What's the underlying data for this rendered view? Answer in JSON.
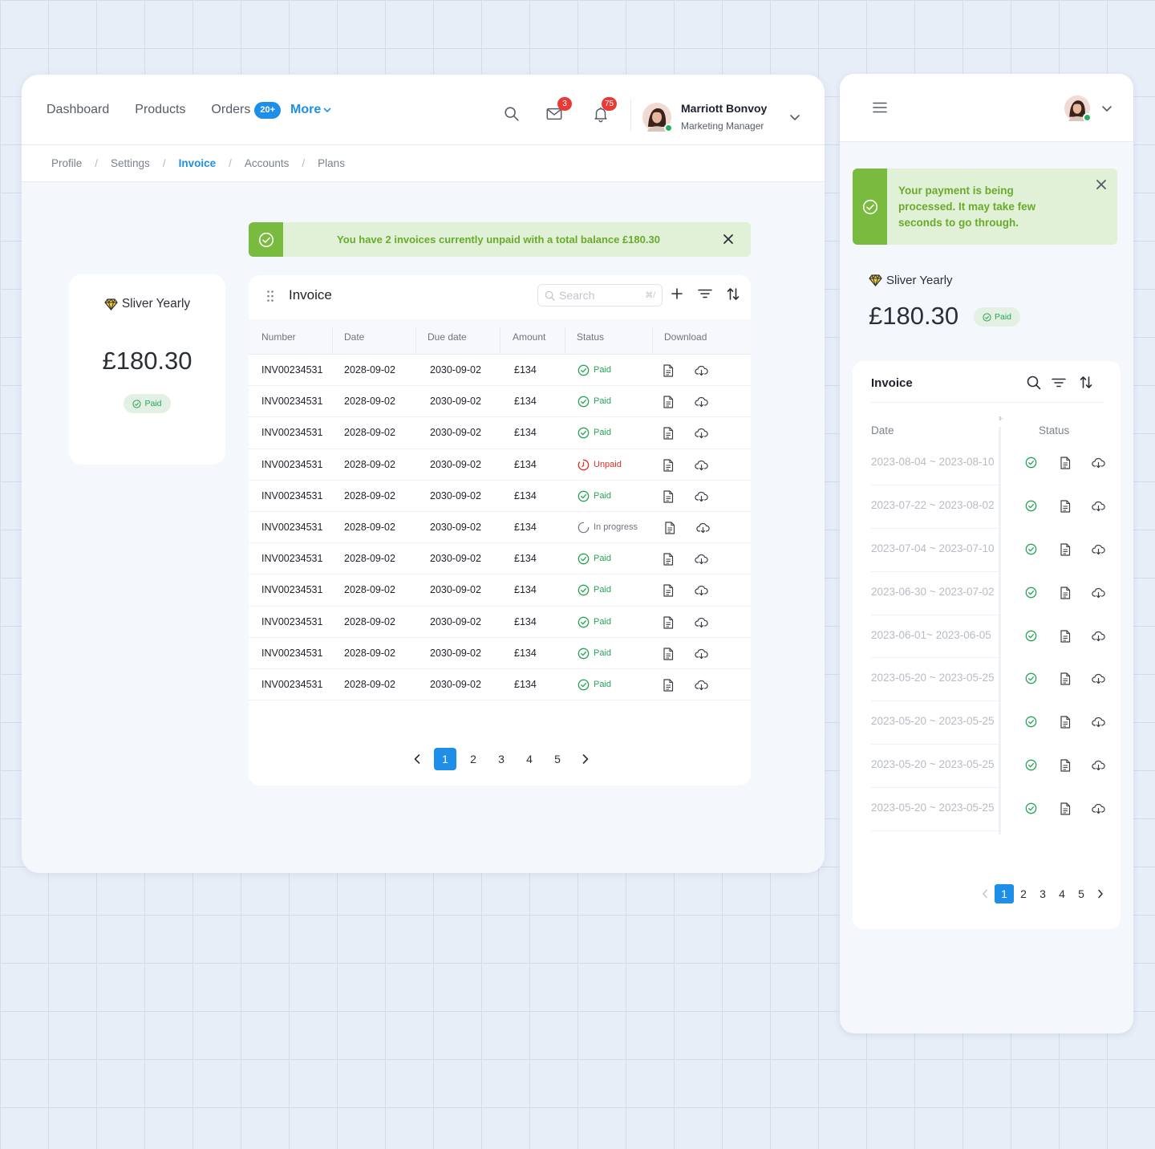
{
  "desktop": {
    "nav": {
      "dashboard": "Dashboard",
      "products": "Products",
      "orders": "Orders",
      "orders_badge": "20+",
      "more": "More"
    },
    "mail_count": "3",
    "notification_count": "75",
    "user": {
      "name": "Marriott Bonvoy",
      "role": "Marketing Manager"
    },
    "breadcrumb": [
      "Profile",
      "Settings",
      "Invoice",
      "Accounts",
      "Plans"
    ],
    "breadcrumb_active": "Invoice",
    "alert_text": "You have 2 invoices currently unpaid with a total balance £180.30",
    "plan": {
      "name": "Sliver Yearly",
      "price": "£180.30",
      "status": "Paid"
    },
    "invoice": {
      "title": "Invoice",
      "search_placeholder": "Search",
      "search_shortcut": "⌘/",
      "columns": [
        "Number",
        "Date",
        "Due date",
        "Amount",
        "Status",
        "Download"
      ],
      "rows": [
        {
          "number": "INV00234531",
          "date": "2028-09-02",
          "due": "2030-09-02",
          "amount": "£134",
          "status": "Paid",
          "type": "paid"
        },
        {
          "number": "INV00234531",
          "date": "2028-09-02",
          "due": "2030-09-02",
          "amount": "£134",
          "status": "Paid",
          "type": "paid"
        },
        {
          "number": "INV00234531",
          "date": "2028-09-02",
          "due": "2030-09-02",
          "amount": "£134",
          "status": "Paid",
          "type": "paid"
        },
        {
          "number": "INV00234531",
          "date": "2028-09-02",
          "due": "2030-09-02",
          "amount": "£134",
          "status": "Unpaid",
          "type": "unpaid"
        },
        {
          "number": "INV00234531",
          "date": "2028-09-02",
          "due": "2030-09-02",
          "amount": "£134",
          "status": "Paid",
          "type": "paid"
        },
        {
          "number": "INV00234531",
          "date": "2028-09-02",
          "due": "2030-09-02",
          "amount": "£134",
          "status": "In progress",
          "type": "progress"
        },
        {
          "number": "INV00234531",
          "date": "2028-09-02",
          "due": "2030-09-02",
          "amount": "£134",
          "status": "Paid",
          "type": "paid"
        },
        {
          "number": "INV00234531",
          "date": "2028-09-02",
          "due": "2030-09-02",
          "amount": "£134",
          "status": "Paid",
          "type": "paid"
        },
        {
          "number": "INV00234531",
          "date": "2028-09-02",
          "due": "2030-09-02",
          "amount": "£134",
          "status": "Paid",
          "type": "paid"
        },
        {
          "number": "INV00234531",
          "date": "2028-09-02",
          "due": "2030-09-02",
          "amount": "£134",
          "status": "Paid",
          "type": "paid"
        },
        {
          "number": "INV00234531",
          "date": "2028-09-02",
          "due": "2030-09-02",
          "amount": "£134",
          "status": "Paid",
          "type": "paid"
        }
      ],
      "pages": [
        "1",
        "2",
        "3",
        "4",
        "5"
      ],
      "current_page": "1"
    }
  },
  "mobile": {
    "alert_text": "Your payment is being processed. It may take few seconds to go through.",
    "plan": {
      "name": "Sliver Yearly",
      "price": "£180.30",
      "status": "Paid"
    },
    "invoice": {
      "title": "Invoice",
      "col_date": "Date",
      "col_status": "Status",
      "rows": [
        "2023-08-04 ~ 2023-08-10",
        "2023-07-22 ~ 2023-08-02",
        "2023-07-04 ~ 2023-07-10",
        "2023-06-30 ~ 2023-07-02",
        "2023-06-01~ 2023-06-05",
        "2023-05-20 ~ 2023-05-25",
        "2023-05-20 ~ 2023-05-25",
        "2023-05-20 ~ 2023-05-25",
        "2023-05-20 ~ 2023-05-25"
      ],
      "pages": [
        "1",
        "2",
        "3",
        "4",
        "5"
      ],
      "current_page": "1"
    }
  },
  "colors": {
    "accent": "#1d8fe8",
    "success": "#27a557",
    "danger": "#d93025",
    "alert_bg": "#e0f1d7",
    "alert_icon_bg": "#79bb3f"
  },
  "icons": [
    "search-icon",
    "mail-icon",
    "bell-icon",
    "chevron-down-icon",
    "check-circle-icon",
    "close-icon",
    "diamond-icon",
    "drag-handle-icon",
    "plus-icon",
    "filter-icon",
    "sort-icon",
    "document-icon",
    "cloud-download-icon",
    "menu-icon",
    "chevron-left-icon",
    "chevron-right-icon"
  ]
}
